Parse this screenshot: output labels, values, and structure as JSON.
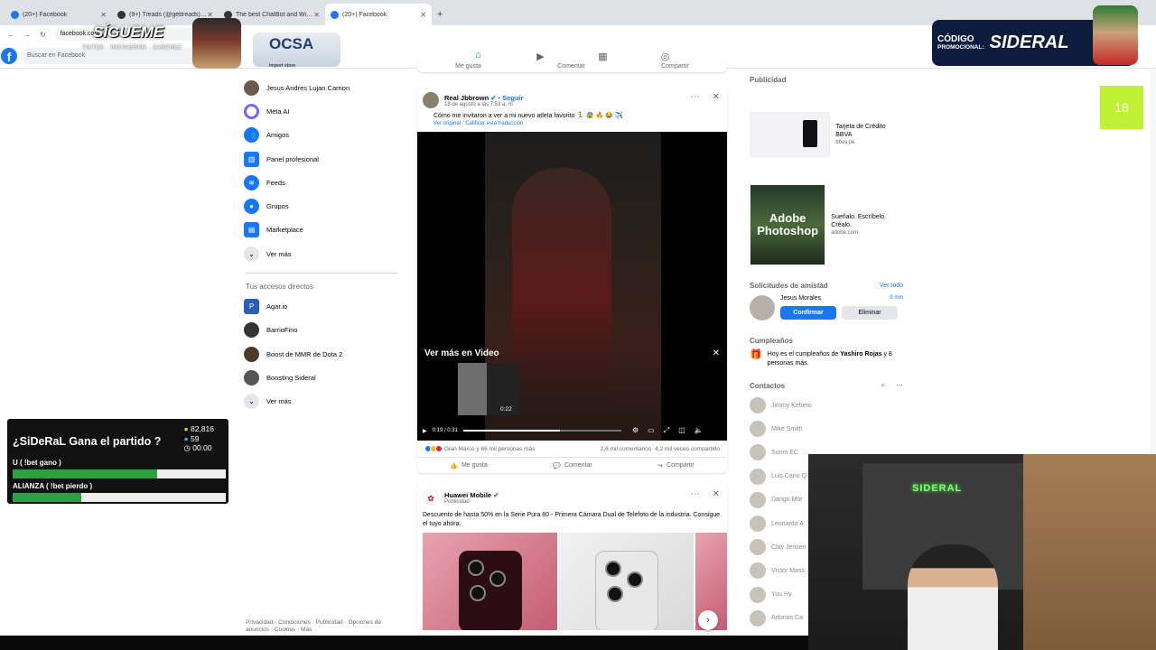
{
  "browser": {
    "tabs": [
      {
        "title": "(20+) Facebook",
        "active": false
      },
      {
        "title": "(9+) Treads (@gettreads) · Tr",
        "active": false
      },
      {
        "title": "The best ChatBot and Widgets",
        "active": false
      },
      {
        "title": "(20+) Facebook",
        "active": true
      }
    ],
    "new_tab": "+",
    "address": "facebook.com"
  },
  "fb_nav": {
    "logo": "f",
    "search_placeholder": "Buscar en Facebook"
  },
  "left_sidebar": {
    "items": [
      {
        "label": "Jesus Andres Lujan Carrion",
        "icon": "avatar",
        "color": "#6b5a4e"
      },
      {
        "label": "Meta AI",
        "icon": "meta-ai-icon",
        "color": "#7b61ff"
      },
      {
        "label": "Amigos",
        "icon": "friends-icon",
        "color": "#1877f2"
      },
      {
        "label": "Panel profesional",
        "icon": "dashboard-icon",
        "color": "#1877f2"
      },
      {
        "label": "Feeds",
        "icon": "feeds-icon",
        "color": "#1877f2"
      },
      {
        "label": "Grupos",
        "icon": "groups-icon",
        "color": "#1877f2"
      },
      {
        "label": "Marketplace",
        "icon": "marketplace-icon",
        "color": "#1877f2"
      },
      {
        "label": "Ver más",
        "icon": "chevron-down-icon",
        "color": "#e4e6eb"
      }
    ],
    "shortcuts_title": "Tus accesos directos",
    "shortcuts": [
      {
        "label": "Agar.io",
        "color": "#2a5fb8"
      },
      {
        "label": "BarrioFino",
        "color": "#333333"
      },
      {
        "label": "Boost de MMR de Dota 2",
        "color": "#4a3a2a"
      },
      {
        "label": "Boosting Sideral",
        "color": "#555555"
      },
      {
        "label": "Ver más",
        "color": "#e4e6eb"
      }
    ],
    "footer": "Privacidad · Condiciones · Publicidad · Opciones de anuncios · Cookies · Más"
  },
  "feed": {
    "top_actions": {
      "like": "Me gusta",
      "comment": "Comentar",
      "share": "Compartir"
    },
    "post1": {
      "author": "Real Jbbrown",
      "follow": "Seguir",
      "meta": "18 de agosto a las 7:53 a. m. ·",
      "text": "Cómo me invitaron a ver a mi nuevo atleta favorito 🏃 😰 🔥 😂 ✈️",
      "translation": "Ver original · Calificar esta traducción",
      "video": {
        "overlay_title": "Ver más en Video",
        "thumb_duration": "0:22",
        "time": "0:19 / 0:31",
        "progress": 0.61
      },
      "reactions": "Gian Marco y 66 mil personas más",
      "comments": "2,6 mil comentarios",
      "shares": "4,2 mil veces compartido",
      "actions": {
        "like": "Me gusta",
        "comment": "Comentar",
        "share": "Compartir"
      }
    },
    "post2": {
      "author": "Huawei Mobile",
      "meta": "Publicidad ·",
      "text": "Descuento de hasta 50% en la Serie Pura 80 - Primera Cámara Dual de Telefoto de la industria. Consigue el tuyo ahora."
    }
  },
  "right_sidebar": {
    "ads_title": "Publicidad",
    "ads": [
      {
        "title": "Tarjeta de Crédito BBVA",
        "domain": "bbva.pe"
      },
      {
        "title": "Sueñalo. Escríbelo. Créalo.",
        "domain": "adobe.com",
        "image_text": "Adobe Photoshop"
      }
    ],
    "requests_title": "Solicitudes de amistad",
    "requests_link": "Ver todo",
    "request": {
      "name": "Jesus Morales",
      "time": "9 min",
      "confirm": "Confirmar",
      "delete": "Eliminar"
    },
    "birthdays_title": "Cumpleaños",
    "birthday_pre": "Hoy es el cumpleaños de ",
    "birthday_name": "Yashiro Rojas",
    "birthday_post": " y 8 personas más.",
    "contacts_title": "Contactos",
    "contacts": [
      "Jimmy Kehero",
      "Mike Smith",
      "Sunm EC",
      "Luis Cano Q",
      "Dango Mor",
      "Leonardo A",
      "Clay Jensen",
      "Víctor Mass",
      "Yuu Hy",
      "Artorias Ca"
    ]
  },
  "poll": {
    "question": "¿SiDeRaL Gana el partido ?",
    "coins": "82,816",
    "users": "59",
    "timer": "00:00",
    "options": [
      {
        "label": "U ( !bet gano )",
        "fraction": 0.68
      },
      {
        "label": "ALIANZA ( !bet pierdo )",
        "fraction": 0.32
      }
    ]
  },
  "overlays": {
    "sigueme": "SÍGUEME",
    "sigueme_sub": "TIKTOK · INSTAGRAM · SANCHEZ",
    "ocsa": "OCSA",
    "ocsa_sub": "import store",
    "promo_label": "CÓDIGO",
    "promo_label2": "PROMOCIONAL:",
    "promo_code": "SIDERAL",
    "green_box": "18",
    "neon": "SIDERAL"
  }
}
